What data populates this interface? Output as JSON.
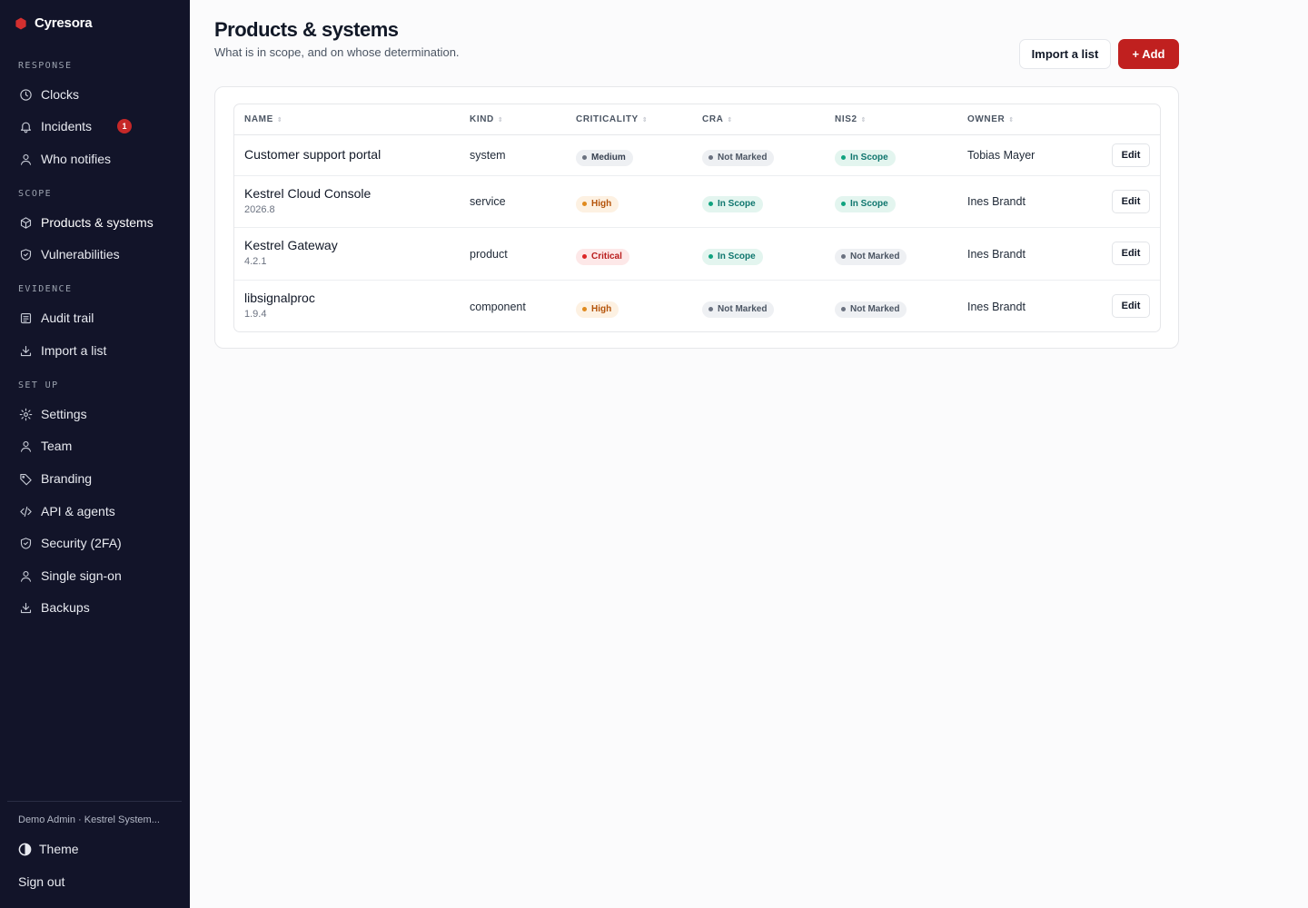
{
  "brand": {
    "name": "Cyresora",
    "color": "#d32f2f"
  },
  "sidebar": {
    "sections": [
      {
        "title": "RESPONSE",
        "items": [
          {
            "label": "Clocks",
            "icon": "clock-icon"
          },
          {
            "label": "Incidents",
            "icon": "bell-icon",
            "badge": "1"
          },
          {
            "label": "Who notifies",
            "icon": "user-icon"
          }
        ]
      },
      {
        "title": "SCOPE",
        "items": [
          {
            "label": "Products & systems",
            "icon": "box-icon",
            "active": true
          },
          {
            "label": "Vulnerabilities",
            "icon": "shield-icon"
          }
        ]
      },
      {
        "title": "EVIDENCE",
        "items": [
          {
            "label": "Audit trail",
            "icon": "list-icon"
          },
          {
            "label": "Import a list",
            "icon": "download-icon"
          }
        ]
      },
      {
        "title": "SET UP",
        "items": [
          {
            "label": "Settings",
            "icon": "gear-icon"
          },
          {
            "label": "Team",
            "icon": "user-icon"
          },
          {
            "label": "Branding",
            "icon": "tag-icon"
          },
          {
            "label": "API & agents",
            "icon": "code-icon"
          },
          {
            "label": "Security (2FA)",
            "icon": "shield-icon"
          },
          {
            "label": "Single sign-on",
            "icon": "user-icon"
          },
          {
            "label": "Backups",
            "icon": "download-icon"
          }
        ]
      }
    ],
    "account": "Demo Admin · Kestrel System...",
    "theme_label": "Theme",
    "signout_label": "Sign out"
  },
  "header": {
    "title": "Products & systems",
    "subtitle": "What is in scope, and on whose determination.",
    "import_label": "Import a list",
    "add_label": "+ Add"
  },
  "table": {
    "columns": [
      "NAME",
      "KIND",
      "CRITICALITY",
      "CRA",
      "NIS2",
      "OWNER"
    ],
    "rows": [
      {
        "name": "Customer support portal",
        "version": "",
        "kind": "system",
        "criticality": "Medium",
        "cra": "Not Marked",
        "nis2": "In Scope",
        "owner": "Tobias Mayer",
        "action": "Edit"
      },
      {
        "name": "Kestrel Cloud Console",
        "version": "2026.8",
        "kind": "service",
        "criticality": "High",
        "cra": "In Scope",
        "nis2": "In Scope",
        "owner": "Ines Brandt",
        "action": "Edit"
      },
      {
        "name": "Kestrel Gateway",
        "version": "4.2.1",
        "kind": "product",
        "criticality": "Critical",
        "cra": "In Scope",
        "nis2": "Not Marked",
        "owner": "Ines Brandt",
        "action": "Edit"
      },
      {
        "name": "libsignalproc",
        "version": "1.9.4",
        "kind": "component",
        "criticality": "High",
        "cra": "Not Marked",
        "nis2": "Not Marked",
        "owner": "Ines Brandt",
        "action": "Edit"
      }
    ]
  },
  "pill_colors": {
    "Medium": {
      "bg": "#eef0f3",
      "fg": "#374151",
      "dot": "#6b7280"
    },
    "High": {
      "bg": "#fdf1e2",
      "fg": "#b45309",
      "dot": "#e08a1e"
    },
    "Critical": {
      "bg": "#fde8e8",
      "fg": "#b91c1c",
      "dot": "#dc2626"
    },
    "In Scope": {
      "bg": "#e3f5ef",
      "fg": "#0f766e",
      "dot": "#10a37f"
    },
    "Not Marked": {
      "bg": "#eef0f3",
      "fg": "#4b5563",
      "dot": "#6b7280"
    }
  }
}
